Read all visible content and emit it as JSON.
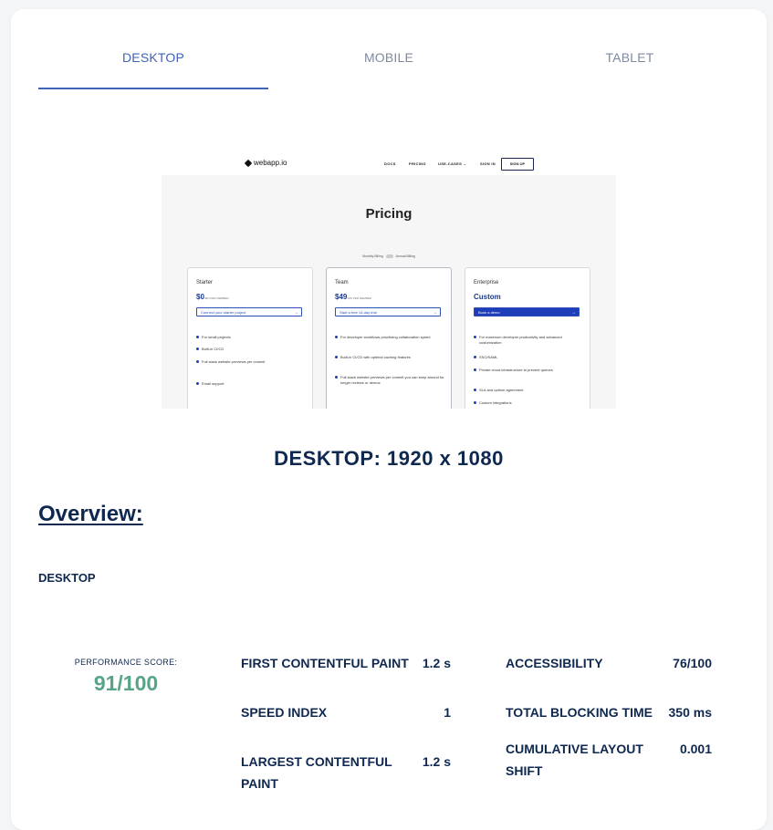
{
  "tabs": [
    {
      "label": "DESKTOP",
      "active": true
    },
    {
      "label": "MOBILE",
      "active": false
    },
    {
      "label": "TABLET",
      "active": false
    }
  ],
  "preview": {
    "logo": "webapp.io",
    "nav": [
      "DOCS",
      "PRICING",
      "USE-CASES ⌄",
      "SIGN IN"
    ],
    "signup": "SIGN UP",
    "title": "Pricing",
    "toggle_left": "Monthly Billing",
    "toggle_right": "Annual Billing",
    "plans": [
      {
        "name": "Starter",
        "price": "$0",
        "price_unit": "/MO PER MEMBER",
        "cta": "Connect your starter project",
        "features": [
          "For small projects",
          "Built-in CI/CD",
          "Full stack website previews per commit",
          "Email support"
        ]
      },
      {
        "name": "Team",
        "price": "$49",
        "price_unit": "/MO PER MEMBER",
        "cta": "Start a free 14-day trial",
        "features": [
          "For developer workflows prioritizing collaboration speed",
          "Built-in CI/CD with optimal caching features",
          "Full stack website previews per commit you can keep around for longer reviews or demos"
        ]
      },
      {
        "name": "Enterprise",
        "price": "Custom",
        "price_unit": "",
        "cta": "Book a demo",
        "features": [
          "For maximum developer productivity and advanced customization",
          "SSO/SAML",
          "Private cloud infrastructure to prevent queues",
          "SLA and uptime agreement",
          "Custom integrations"
        ]
      }
    ]
  },
  "device_title": "DESKTOP: 1920 x 1080",
  "overview_heading": "Overview:",
  "section_label": "DESKTOP",
  "performance": {
    "label": "PERFORMANCE SCORE:",
    "value": "91/100"
  },
  "metrics_left": [
    {
      "name": "FIRST CONTENTFUL PAINT",
      "value": "1.2 s"
    },
    {
      "name": "SPEED INDEX",
      "value": "1"
    },
    {
      "name": "LARGEST CONTENTFUL PAINT",
      "value": "1.2 s"
    }
  ],
  "metrics_right": [
    {
      "name": "ACCESSIBILITY",
      "value": "76/100"
    },
    {
      "name": "TOTAL BLOCKING TIME",
      "value": "350 ms"
    },
    {
      "name": "CUMULATIVE LAYOUT SHIFT",
      "value": "0.001"
    }
  ],
  "colors": {
    "accent": "#3f63b8",
    "heading": "#0f2850",
    "score_good": "#57a586"
  }
}
